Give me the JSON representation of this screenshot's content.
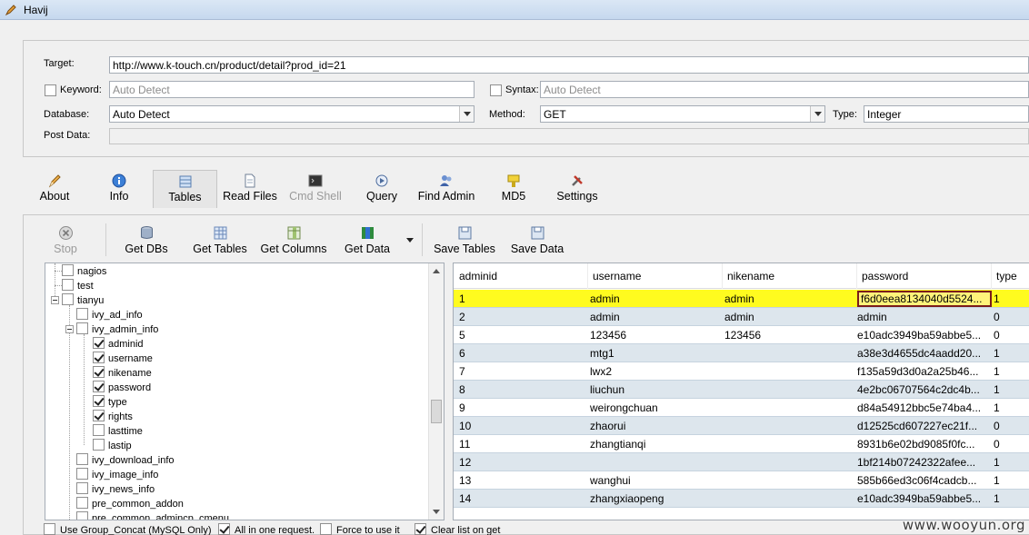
{
  "window": {
    "title": "Havij"
  },
  "form": {
    "target_label": "Target:",
    "target_value": "http://www.k-touch.cn/product/detail?prod_id=21",
    "keyword_label": "Keyword:",
    "keyword_placeholder": "Auto Detect",
    "syntax_label": "Syntax:",
    "syntax_placeholder": "Auto Detect",
    "database_label": "Database:",
    "database_value": "Auto Detect",
    "method_label": "Method:",
    "method_value": "GET",
    "type_label": "Type:",
    "type_value": "Integer",
    "post_data_label": "Post Data:"
  },
  "tabs": [
    {
      "label": "About",
      "icon": "pencil-icon"
    },
    {
      "label": "Info",
      "icon": "info-icon"
    },
    {
      "label": "Tables",
      "icon": "table-icon",
      "active": true
    },
    {
      "label": "Read Files",
      "icon": "document-icon"
    },
    {
      "label": "Cmd Shell",
      "icon": "terminal-icon",
      "disabled": true
    },
    {
      "label": "Query",
      "icon": "query-icon"
    },
    {
      "label": "Find Admin",
      "icon": "users-icon"
    },
    {
      "label": "MD5",
      "icon": "key-icon"
    },
    {
      "label": "Settings",
      "icon": "tools-icon"
    }
  ],
  "toolbar": [
    {
      "label": "Stop",
      "icon": "stop-icon",
      "disabled": true
    },
    {
      "label": "Get DBs",
      "icon": "database-icon"
    },
    {
      "label": "Get Tables",
      "icon": "grid-icon"
    },
    {
      "label": "Get Columns",
      "icon": "columns-icon"
    },
    {
      "label": "Get Data",
      "icon": "data-icon"
    },
    {
      "label": "Save Tables",
      "icon": "save-icon"
    },
    {
      "label": "Save Data",
      "icon": "save-icon"
    }
  ],
  "tree": [
    {
      "label": "nagios",
      "checked": false
    },
    {
      "label": "test",
      "checked": false
    },
    {
      "label": "tianyu",
      "checked": false
    },
    {
      "label": "ivy_ad_info",
      "checked": false
    },
    {
      "label": "ivy_admin_info",
      "checked": false
    },
    {
      "label": "adminid",
      "checked": true
    },
    {
      "label": "username",
      "checked": true
    },
    {
      "label": "nikename",
      "checked": true
    },
    {
      "label": "password",
      "checked": true
    },
    {
      "label": "type",
      "checked": true
    },
    {
      "label": "rights",
      "checked": true
    },
    {
      "label": "lasttime",
      "checked": false
    },
    {
      "label": "lastip",
      "checked": false
    },
    {
      "label": "ivy_download_info",
      "checked": false
    },
    {
      "label": "ivy_image_info",
      "checked": false
    },
    {
      "label": "ivy_news_info",
      "checked": false
    },
    {
      "label": "pre_common_addon",
      "checked": false
    },
    {
      "label": "pre_common_admincp_cmenu",
      "checked": false
    }
  ],
  "grid": {
    "columns": [
      "adminid",
      "username",
      "nikename",
      "password",
      "type"
    ],
    "rows": [
      [
        "1",
        "admin",
        "admin",
        "f6d0eea8134040d5524...",
        "1"
      ],
      [
        "2",
        "admin",
        "admin",
        "admin",
        "0"
      ],
      [
        "5",
        "123456",
        "123456",
        "e10adc3949ba59abbe5...",
        "0"
      ],
      [
        "6",
        "mtg1",
        "",
        "a38e3d4655dc4aadd20...",
        "1"
      ],
      [
        "7",
        "lwx2",
        "",
        "f135a59d3d0a2a25b46...",
        "1"
      ],
      [
        "8",
        "liuchun",
        "",
        "4e2bc06707564c2dc4b...",
        "1"
      ],
      [
        "9",
        "weirongchuan",
        "",
        "d84a54912bbc5e74ba4...",
        "1"
      ],
      [
        "10",
        "zhaorui",
        "",
        "d12525cd607227ec21f...",
        "0"
      ],
      [
        "11",
        "zhangtianqi",
        "",
        "8931b6e02bd9085f0fc...",
        "0"
      ],
      [
        "12",
        "",
        "",
        "1bf214b07242322afee...",
        "1"
      ],
      [
        "13",
        "wanghui",
        "",
        "585b66ed3c06f4cadcb...",
        "1"
      ],
      [
        "14",
        "zhangxiaopeng",
        "",
        "e10adc3949ba59abbe5...",
        "1"
      ]
    ]
  },
  "options": [
    {
      "label": "Use Group_Concat (MySQL Only)",
      "checked": false
    },
    {
      "label": "All in one request.",
      "checked": true
    },
    {
      "label": "Force to use it",
      "checked": false
    },
    {
      "label": "Clear list on get",
      "checked": true
    }
  ],
  "watermark": "www.wooyun.org"
}
